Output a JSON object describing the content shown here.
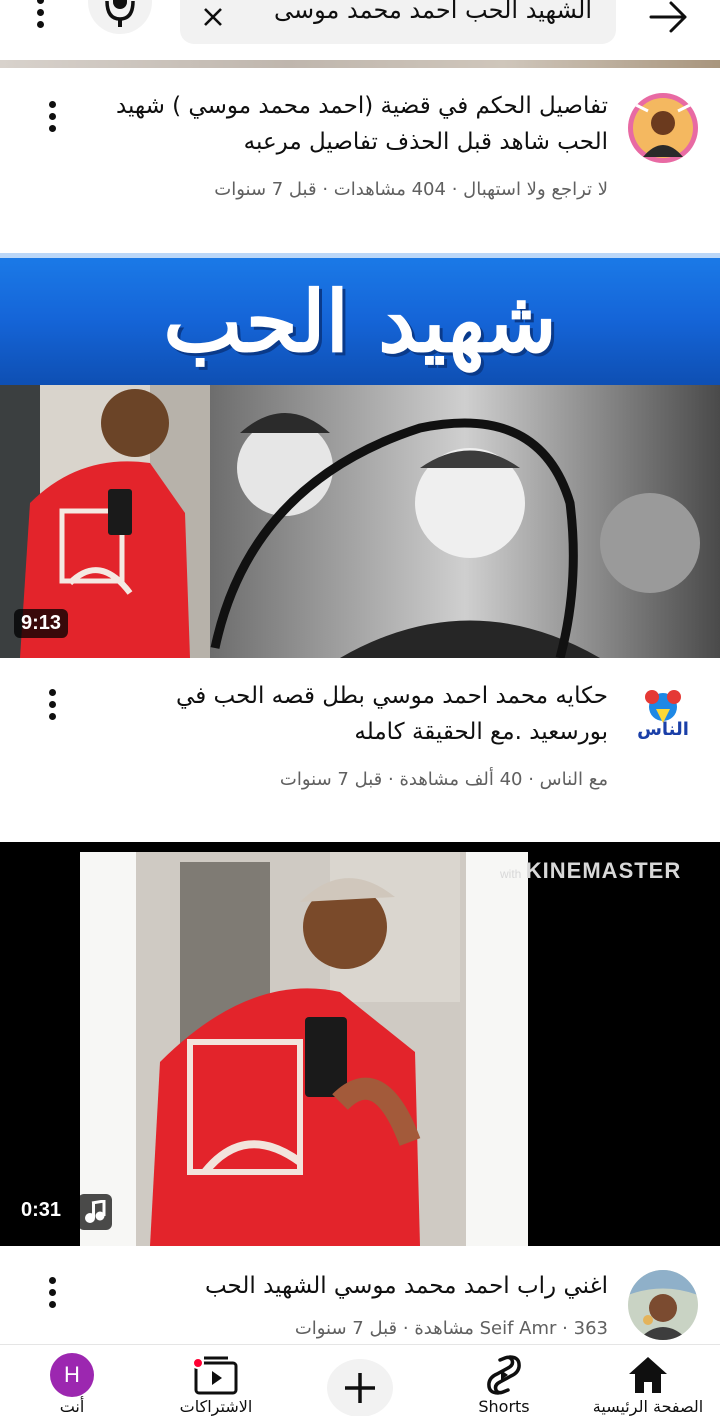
{
  "search": {
    "query": "الشهيد الحب احمد محمد موسى"
  },
  "icons": {
    "more": "more-vert-icon",
    "mic": "mic-icon",
    "clear": "close-icon",
    "back": "arrow-back-icon",
    "music": "music-note-icon"
  },
  "videos": [
    {
      "title": "تفاصيل الحكم في قضية (احمد محمد موسي ) شهيد الحب شاهد قبل الحذف تفاصيل مرعبه",
      "channel": "لا تراجع ولا استهبال",
      "views": "404 مشاهدات",
      "age": "قبل 7 سنوات"
    },
    {
      "thumbnail_banner": "شهيد الحب",
      "duration": "9:13",
      "channel_logo_text": "الناس",
      "title": "حكايه محمد احمد موسي بطل قصه الحب في بورسعيد .مع الحقيقة كامله",
      "channel": "مع الناس",
      "views": "40 ألف مشاهدة",
      "age": "قبل 7 سنوات"
    },
    {
      "watermark": "KINEMASTER",
      "watermark_prefix": "with",
      "duration": "0:31",
      "title": "اغني راب احمد محمد موسي الشهيد الحب",
      "channel": "Seif Amr",
      "views": "363 مشاهدة",
      "age": "قبل 7 سنوات"
    }
  ],
  "separator": "·",
  "bottom_nav": {
    "you_initial": "H",
    "you_label": "أنت",
    "subscriptions_label": "الاشتراكات",
    "shorts_label": "Shorts",
    "home_label": "الصفحة الرئيسية"
  },
  "colors": {
    "accent_red": "#ff0033",
    "banner_blue": "#1565d8",
    "avatar_purple": "#9c27b0",
    "secondary_text": "#606060"
  }
}
